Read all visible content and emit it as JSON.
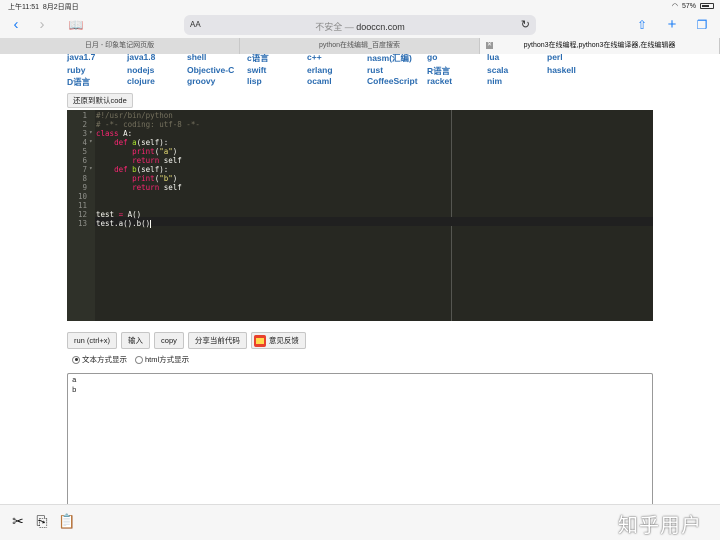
{
  "status": {
    "time": "上午11:51",
    "date": "8月2日周日",
    "battery": "57%"
  },
  "toolbar": {
    "aa_label": "AA",
    "url_insecure": "不安全 — ",
    "url_domain": "dooccn.com"
  },
  "tabs": [
    {
      "label": "日月 - 印象笔记网页版"
    },
    {
      "label": "python在线编辑_百度搜索"
    },
    {
      "label": "python3在线编程,python3在线编译器,在线编辑器"
    }
  ],
  "languages": [
    [
      "java1.7",
      "java1.8",
      "shell",
      "c语言",
      "c++",
      "nasm(汇编)",
      "go",
      "lua",
      "perl"
    ],
    [
      "ruby",
      "nodejs",
      "Objective-C",
      "swift",
      "erlang",
      "rust",
      "R语言",
      "scala",
      "haskell"
    ],
    [
      "D语言",
      "clojure",
      "groovy",
      "lisp",
      "ocaml",
      "CoffeeScript",
      "racket",
      "nim"
    ]
  ],
  "reset_label": "还原到默认code",
  "editor": {
    "line_numbers": [
      "1",
      "2",
      "3",
      "4",
      "5",
      "6",
      "7",
      "8",
      "9",
      "10",
      "11",
      "12",
      "13"
    ],
    "lines": {
      "l1": "#!/usr/bin/python",
      "l2": "# -*- coding: utf-8 -*-",
      "l3_kw": "class",
      "l3_rest": " A:",
      "l4_kw": "def",
      "l4_fn": "a",
      "l4_rest": "(self):",
      "l5_kw": "print",
      "l5_pre": "(",
      "l5_str": "\"a\"",
      "l5_post": ")",
      "l6_kw": "return",
      "l6_rest": " self",
      "l7_kw": "def",
      "l7_fn": "b",
      "l7_rest": "(self):",
      "l8_kw": "print",
      "l8_pre": "(",
      "l8_str": "\"b\"",
      "l8_post": ")",
      "l9_kw": "return",
      "l9_rest": " self",
      "l12_a": "test ",
      "l12_op": "=",
      "l12_b": " A()",
      "l13": "test.a().b()"
    }
  },
  "buttons": {
    "run": "run (ctrl+x)",
    "input": "输入",
    "copy": "copy",
    "share": "分享当前代码",
    "feedback": "意见反馈"
  },
  "radios": {
    "text_mode": "文本方式显示",
    "html_mode": "html方式显示"
  },
  "output_lines": [
    "a",
    "b"
  ],
  "watermark": "知乎用户"
}
